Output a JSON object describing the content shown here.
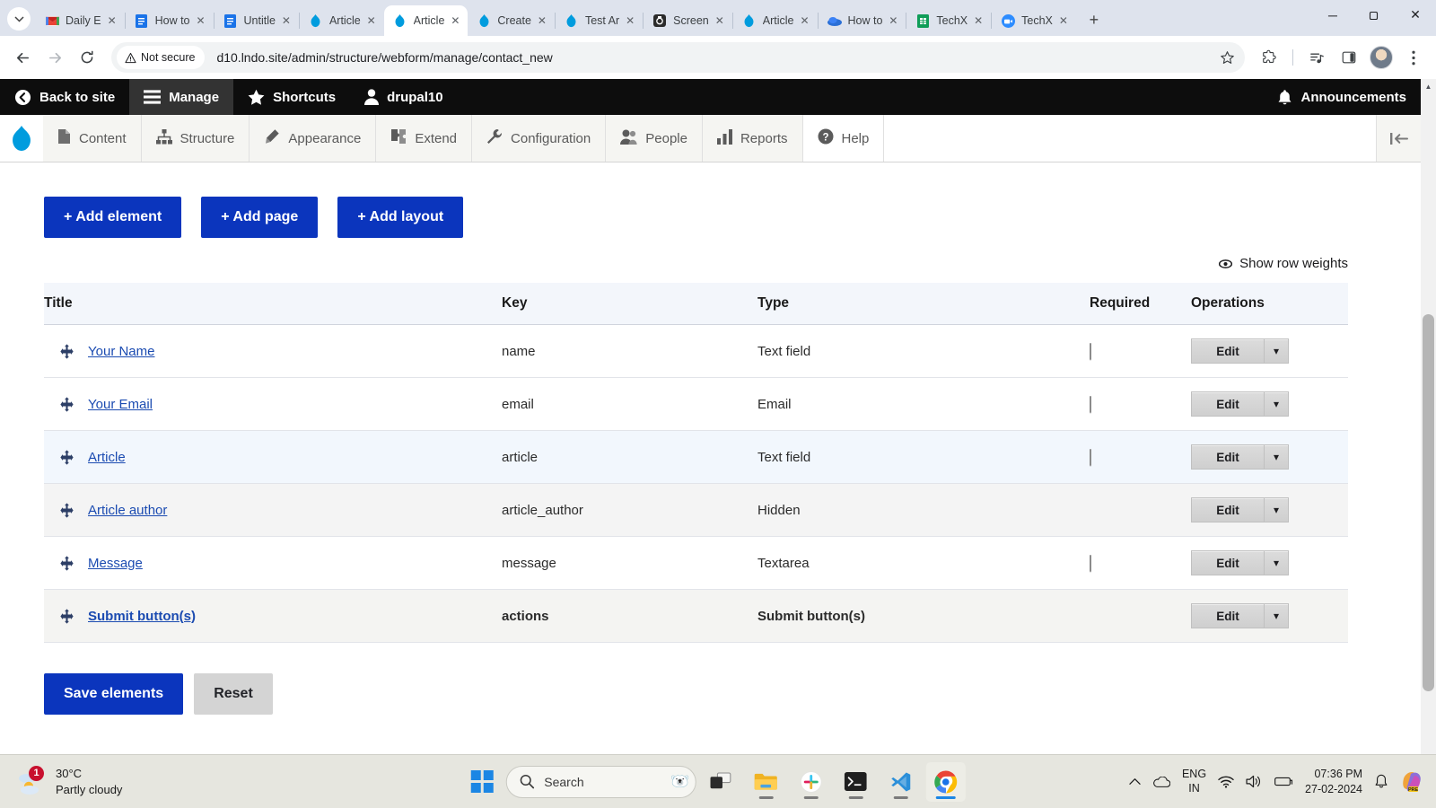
{
  "browser": {
    "tabs": [
      {
        "title": "Daily E",
        "favicon": "gmail-icon",
        "active": false
      },
      {
        "title": "How to",
        "favicon": "docs-icon",
        "active": false
      },
      {
        "title": "Untitle",
        "favicon": "docs-icon",
        "active": false
      },
      {
        "title": "Article",
        "favicon": "drupal-icon",
        "active": false
      },
      {
        "title": "Article",
        "favicon": "drupal-icon",
        "active": true
      },
      {
        "title": "Create",
        "favicon": "drupal-icon",
        "active": false
      },
      {
        "title": "Test Ar",
        "favicon": "drupal-icon",
        "active": false
      },
      {
        "title": "Screen",
        "favicon": "screen-icon",
        "active": false
      },
      {
        "title": "Article",
        "favicon": "drupal-icon",
        "active": false
      },
      {
        "title": "How to",
        "favicon": "cloud-icon",
        "active": false
      },
      {
        "title": "TechX",
        "favicon": "sheets-icon",
        "active": false
      },
      {
        "title": "TechX",
        "favicon": "zoom-icon",
        "active": false
      }
    ],
    "new_tab_label": "+",
    "window_controls": {
      "minimize": "─",
      "maximize": "❐",
      "close": "✕"
    },
    "nav": {
      "back": "←",
      "forward": "→",
      "reload": "↻"
    },
    "security_label": "Not secure",
    "url": "d10.lndo.site/admin/structure/webform/manage/contact_new",
    "right_icons": [
      "bookmark-star-icon",
      "extensions-icon",
      "media-control-icon",
      "side-panel-icon",
      "profile-avatar",
      "chrome-menu-icon"
    ]
  },
  "admin_bar": {
    "back_to_site": "Back to site",
    "manage": "Manage",
    "shortcuts": "Shortcuts",
    "user": "drupal10",
    "announcements": "Announcements"
  },
  "admin_tabs": [
    {
      "label": "Content",
      "icon": "content-icon"
    },
    {
      "label": "Structure",
      "icon": "structure-icon"
    },
    {
      "label": "Appearance",
      "icon": "appearance-icon"
    },
    {
      "label": "Extend",
      "icon": "extend-icon"
    },
    {
      "label": "Configuration",
      "icon": "configuration-icon"
    },
    {
      "label": "People",
      "icon": "people-icon"
    },
    {
      "label": "Reports",
      "icon": "reports-icon"
    },
    {
      "label": "Help",
      "icon": "help-icon"
    }
  ],
  "toolbar_actions": {
    "add_element": "+ Add element",
    "add_page": "+ Add page",
    "add_layout": "+ Add layout",
    "show_row_weights": "Show row weights"
  },
  "table": {
    "headers": [
      "Title",
      "Key",
      "Type",
      "Required",
      "Operations"
    ],
    "rows": [
      {
        "title": "Your Name",
        "key": "name",
        "type": "Text field",
        "required": true,
        "edit": "Edit",
        "style": "normal"
      },
      {
        "title": "Your Email",
        "key": "email",
        "type": "Email",
        "required": true,
        "edit": "Edit",
        "style": "normal"
      },
      {
        "title": "Article",
        "key": "article",
        "type": "Text field",
        "required": true,
        "edit": "Edit",
        "style": "highlight"
      },
      {
        "title": "Article author",
        "key": "article_author",
        "type": "Hidden",
        "required": false,
        "edit": "Edit",
        "style": "dim"
      },
      {
        "title": "Message",
        "key": "message",
        "type": "Textarea",
        "required": true,
        "edit": "Edit",
        "style": "normal"
      },
      {
        "title": "Submit button(s)",
        "key": "actions",
        "type": "Submit button(s)",
        "required": false,
        "edit": "Edit",
        "style": "strong"
      }
    ]
  },
  "form_actions": {
    "save": "Save elements",
    "reset": "Reset"
  },
  "taskbar": {
    "weather_temp": "30°C",
    "weather_desc": "Partly cloudy",
    "weather_badge": "1",
    "search_placeholder": "Search",
    "apps": [
      "task-view-icon",
      "file-explorer-icon",
      "slack-icon",
      "terminal-icon",
      "vscode-icon",
      "chrome-icon"
    ],
    "tray_chevron": "^",
    "language_line1": "ENG",
    "language_line2": "IN",
    "time": "07:36 PM",
    "date": "27-02-2024",
    "tray_icons": [
      "onedrive-icon",
      "wifi-icon",
      "volume-icon",
      "battery-icon",
      "notification-bell-icon",
      "copilot-icon"
    ]
  },
  "colors": {
    "drupal_blue": "#0b35bd",
    "link_blue": "#1b4bb1",
    "admin_black": "#0d0d0d",
    "highlight_row": "#f2f7fd"
  }
}
